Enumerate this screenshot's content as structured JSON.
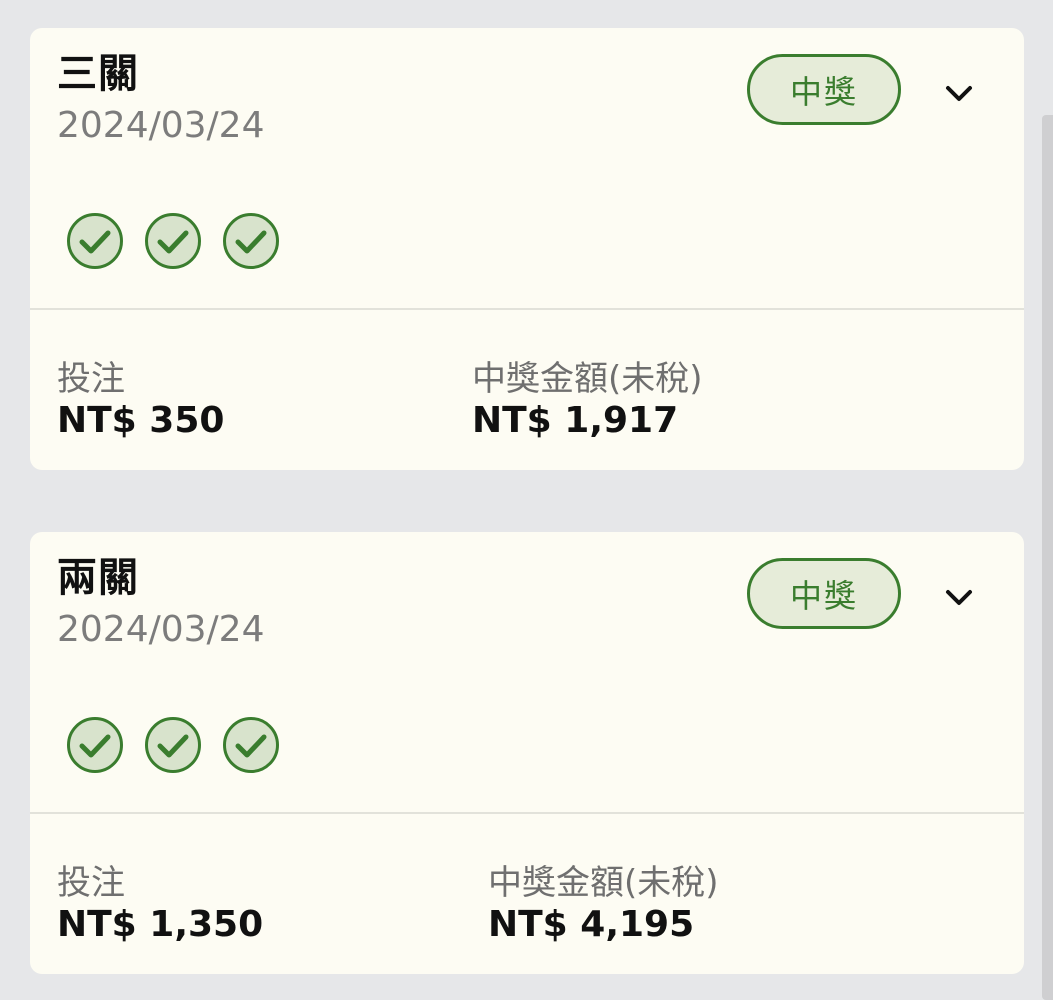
{
  "colors": {
    "background": "#e6e7e9",
    "card": "#fdfcf3",
    "accent_green": "#3a7d2e",
    "badge_fill": "#e6ecd9"
  },
  "cards": [
    {
      "title": "三關",
      "date": "2024/03/24",
      "badge": "中獎",
      "expand_icon": "chevron-down-icon",
      "checks": [
        "check-circle-icon",
        "check-circle-icon",
        "check-circle-icon"
      ],
      "bet_label": "投注",
      "bet_value": "NT$ 350",
      "prize_label": "中獎金額(未稅)",
      "prize_value": "NT$ 1,917"
    },
    {
      "title": "兩關",
      "date": "2024/03/24",
      "badge": "中獎",
      "expand_icon": "chevron-down-icon",
      "checks": [
        "check-circle-icon",
        "check-circle-icon",
        "check-circle-icon"
      ],
      "bet_label": "投注",
      "bet_value": "NT$ 1,350",
      "prize_label": "中獎金額(未稅)",
      "prize_value": "NT$ 4,195"
    }
  ]
}
